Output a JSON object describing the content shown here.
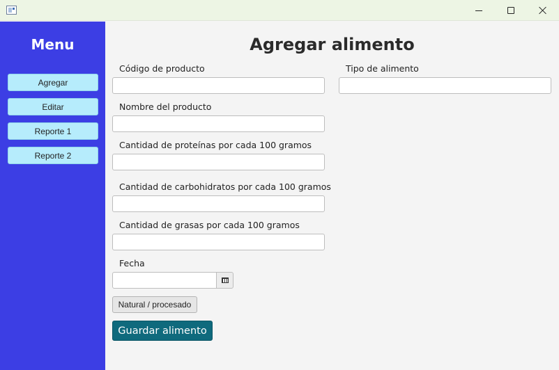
{
  "window": {
    "icons": {
      "app": "app-window-icon",
      "minimize": "minimize-icon",
      "maximize": "maximize-icon",
      "close": "close-icon"
    }
  },
  "sidebar": {
    "title": "Menu",
    "background": "#3c3ee4",
    "button_color": "#b6ecfc",
    "items": [
      {
        "label": "Agregar"
      },
      {
        "label": "Editar"
      },
      {
        "label": "Reporte 1"
      },
      {
        "label": "Reporte 2"
      }
    ]
  },
  "form": {
    "title": "Agregar alimento",
    "fields": {
      "codigo": {
        "label": "Código de producto",
        "value": ""
      },
      "tipo": {
        "label": "Tipo de alimento",
        "value": ""
      },
      "nombre": {
        "label": "Nombre del producto",
        "value": ""
      },
      "proteinas": {
        "label": "Cantidad de proteínas por cada 100 gramos",
        "value": ""
      },
      "carbohidratos": {
        "label": "Cantidad de carbohidratos por cada 100 gramos",
        "value": ""
      },
      "grasas": {
        "label": "Cantidad de grasas por cada 100 gramos",
        "value": ""
      },
      "fecha": {
        "label": "Fecha",
        "value": "",
        "picker_icon": "calendar-icon"
      }
    },
    "toggle_label": "Natural / procesado",
    "save_label": "Guardar alimento",
    "accent": "#0f6a7d"
  }
}
